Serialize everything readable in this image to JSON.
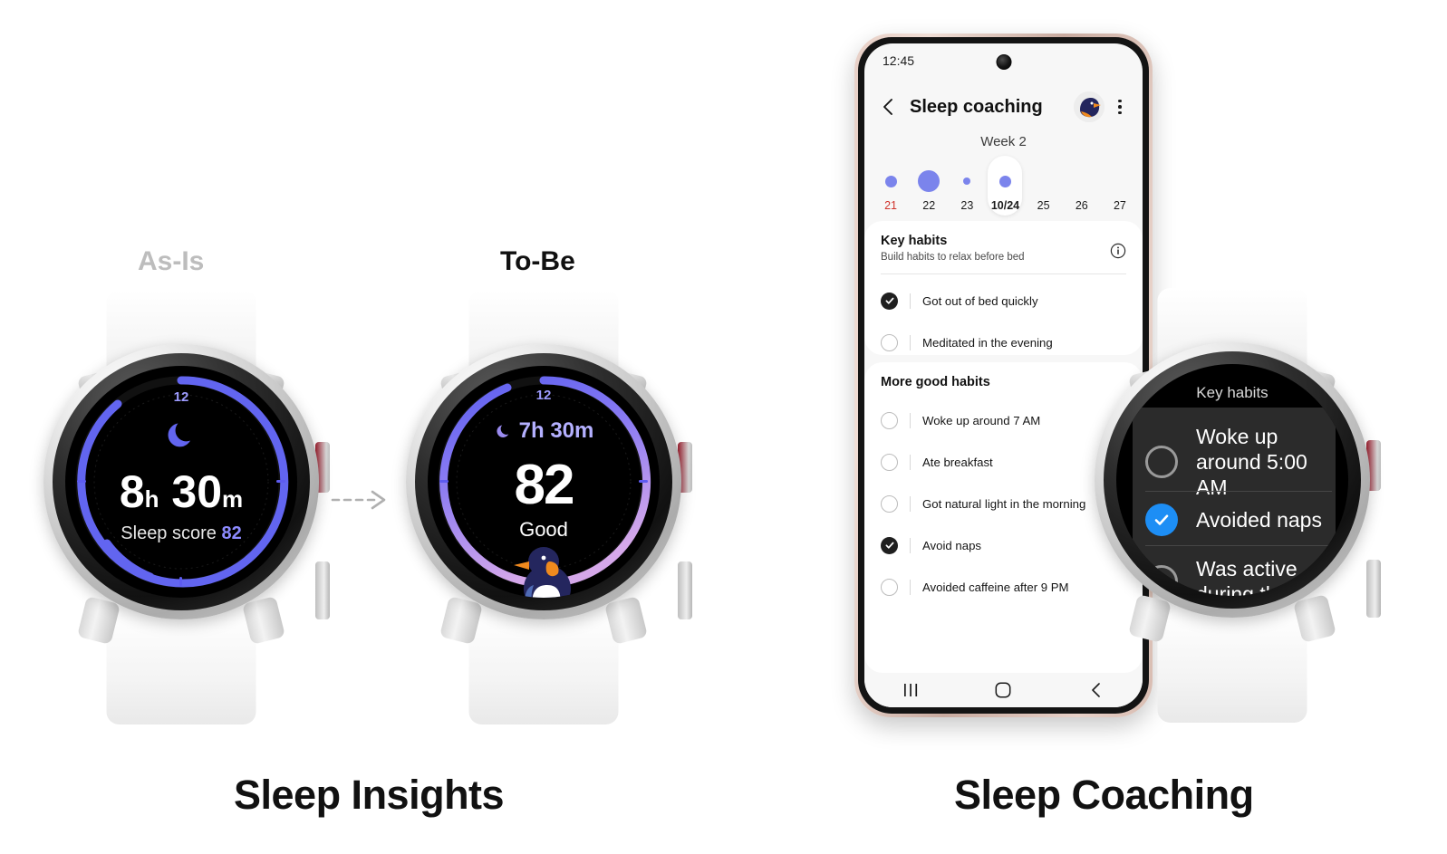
{
  "captions": {
    "left": "Sleep Insights",
    "right": "Sleep Coaching"
  },
  "variants": {
    "as_is": "As-Is",
    "to_be": "To-Be"
  },
  "colors": {
    "ring_accent": "#6265f0",
    "ring_gradient_end": "#c9a0e8",
    "dot_blue": "#7b84ec",
    "watch_check_blue": "#1d8ef5",
    "holiday_red": "#d0342c",
    "as_is_label": "#bdbdbd",
    "to_be_label": "#111111"
  },
  "watch_as_is": {
    "hour_marker": "12",
    "moon_icon": "moon-icon",
    "duration_hours": "8",
    "duration_hours_unit": "h",
    "duration_minutes": "30",
    "duration_minutes_unit": "m",
    "score_label": "Sleep score",
    "score_value": "82"
  },
  "watch_to_be": {
    "hour_marker": "12",
    "moon_icon": "moon-icon",
    "duration": "7h 30m",
    "score_value": "82",
    "score_word": "Good",
    "mascot": "penguin-illustration"
  },
  "watch_key_habits": {
    "title": "Key habits",
    "items": [
      {
        "label": "Woke up around 5:00 AM",
        "checked": false
      },
      {
        "label": "Avoided naps",
        "checked": true
      },
      {
        "label": "Was active during the",
        "checked": false
      }
    ]
  },
  "phone": {
    "status_time": "12:45",
    "back_icon": "back-chevron-icon",
    "app_title": "Sleep coaching",
    "avatar": "penguin-avatar",
    "menu_icon": "kebab-menu-icon",
    "week_label": "Week 2",
    "dates": [
      {
        "num": "21",
        "dot": "medium",
        "selected": false,
        "holiday": true
      },
      {
        "num": "22",
        "dot": "large",
        "selected": false,
        "holiday": false
      },
      {
        "num": "23",
        "dot": "small",
        "selected": false,
        "holiday": false
      },
      {
        "num": "10/24",
        "dot": "medium",
        "selected": true,
        "holiday": false
      },
      {
        "num": "25",
        "dot": "none",
        "selected": false,
        "holiday": false
      },
      {
        "num": "26",
        "dot": "none",
        "selected": false,
        "holiday": false
      },
      {
        "num": "27",
        "dot": "none",
        "selected": false,
        "holiday": false
      }
    ],
    "key_habits": {
      "title": "Key habits",
      "subtitle": "Build habits to relax before bed",
      "info_icon": "info-icon",
      "items": [
        {
          "label": "Got out of bed quickly",
          "checked": true
        },
        {
          "label": "Meditated in the evening",
          "checked": false
        }
      ]
    },
    "more_habits": {
      "title": "More good habits",
      "items": [
        {
          "label": "Woke up around 7 AM",
          "checked": false
        },
        {
          "label": "Ate breakfast",
          "checked": false
        },
        {
          "label": "Got natural light in the morning",
          "checked": false
        },
        {
          "label": "Avoid naps",
          "checked": true
        },
        {
          "label": "Avoided caffeine after 9 PM",
          "checked": false
        }
      ]
    },
    "nav": {
      "recents_icon": "recents-icon",
      "home_icon": "home-icon",
      "back_icon": "back-icon"
    }
  }
}
